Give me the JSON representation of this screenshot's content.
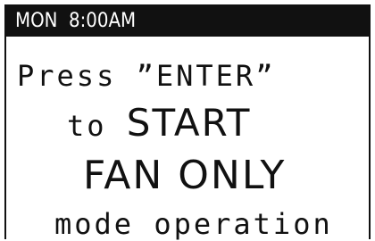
{
  "status_bar": {
    "text": "MON  8:00AM"
  },
  "message": {
    "line1": "Press ”ENTER”",
    "line2_prefix": "to ",
    "line2_emphasis": "START",
    "line3": "FAN ONLY",
    "line4": "mode operation"
  },
  "colors": {
    "background": "#ffffff",
    "text": "#111111",
    "status_bar_bg": "#111111",
    "status_bar_text": "#ffffff"
  }
}
